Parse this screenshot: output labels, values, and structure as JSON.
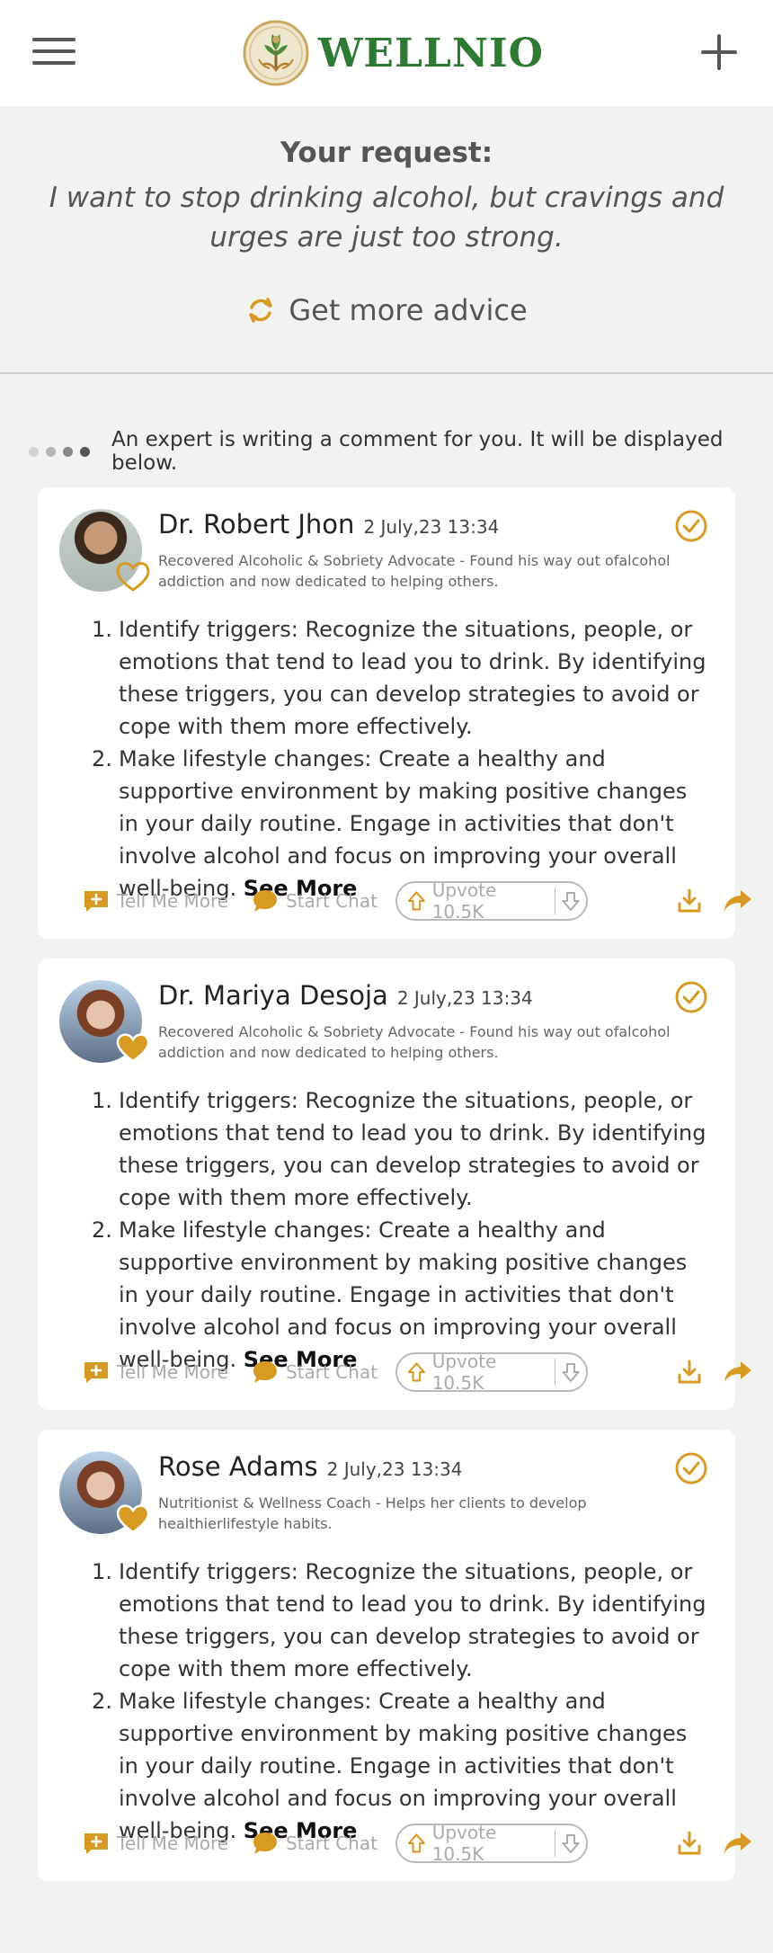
{
  "app": {
    "name": "WELLNIO"
  },
  "request": {
    "label": "Your request:",
    "text": "I want to stop drinking alcohol, but cravings and urges are just too strong.",
    "advice_button": "Get more advice"
  },
  "status": {
    "text": "An expert is writing a comment for you. It will be displayed below."
  },
  "colors": {
    "accent": "#d79b23",
    "brand": "#2f7a33",
    "muted": "#aaaaaa"
  },
  "cards": [
    {
      "name": "Dr. Robert Jhon",
      "date": "2 July,23  13:34",
      "bio": "Recovered Alcoholic & Sobriety Advocate - Found his way out ofalcohol addiction and now dedicated to helping others.",
      "items": [
        {
          "num": "1.",
          "text": "Identify triggers: Recognize the situations, people, or emotions that tend to lead you to drink. By identifying these triggers, you can develop strategies to avoid or cope with them more effectively."
        },
        {
          "num": "2.",
          "text": "Make lifestyle changes: Create a healthy and supportive environment by making positive changes in your daily routine. Engage in activities that don't involve alcohol and focus on improving your overall well-being."
        }
      ],
      "see_more": "See More",
      "tell_me_more": "Tell Me More",
      "start_chat": "Start Chat",
      "upvote": "Upvote 10.5K"
    },
    {
      "name": "Dr. Mariya Desoja",
      "date": "2 July,23  13:34",
      "bio": "Recovered Alcoholic & Sobriety Advocate - Found his way out ofalcohol addiction and now dedicated to helping others.",
      "items": [
        {
          "num": "1.",
          "text": "Identify triggers: Recognize the situations, people, or emotions that tend to lead you to drink. By identifying these triggers, you can develop strategies to avoid or cope with them more effectively."
        },
        {
          "num": "2.",
          "text": "Make lifestyle changes: Create a healthy and supportive environment by making positive changes in your daily routine. Engage in activities that don't involve alcohol and focus on improving your overall well-being."
        }
      ],
      "see_more": "See More",
      "tell_me_more": "Tell Me More",
      "start_chat": "Start Chat",
      "upvote": "Upvote 10.5K"
    },
    {
      "name": "Rose Adams",
      "date": "2 July,23  13:34",
      "bio": "Nutritionist & Wellness Coach - Helps her clients to develop healthierlifestyle habits.",
      "items": [
        {
          "num": "1.",
          "text": "Identify triggers: Recognize the situations, people, or emotions that tend to lead you to drink. By identifying these triggers, you can develop strategies to avoid or cope with them more effectively."
        },
        {
          "num": "2.",
          "text": "Make lifestyle changes: Create a healthy and supportive environment by making positive changes in your daily routine. Engage in activities that don't involve alcohol and focus on improving your overall well-being."
        }
      ],
      "see_more": "See More",
      "tell_me_more": "Tell Me More",
      "start_chat": "Start Chat",
      "upvote": "Upvote 10.5K"
    }
  ]
}
